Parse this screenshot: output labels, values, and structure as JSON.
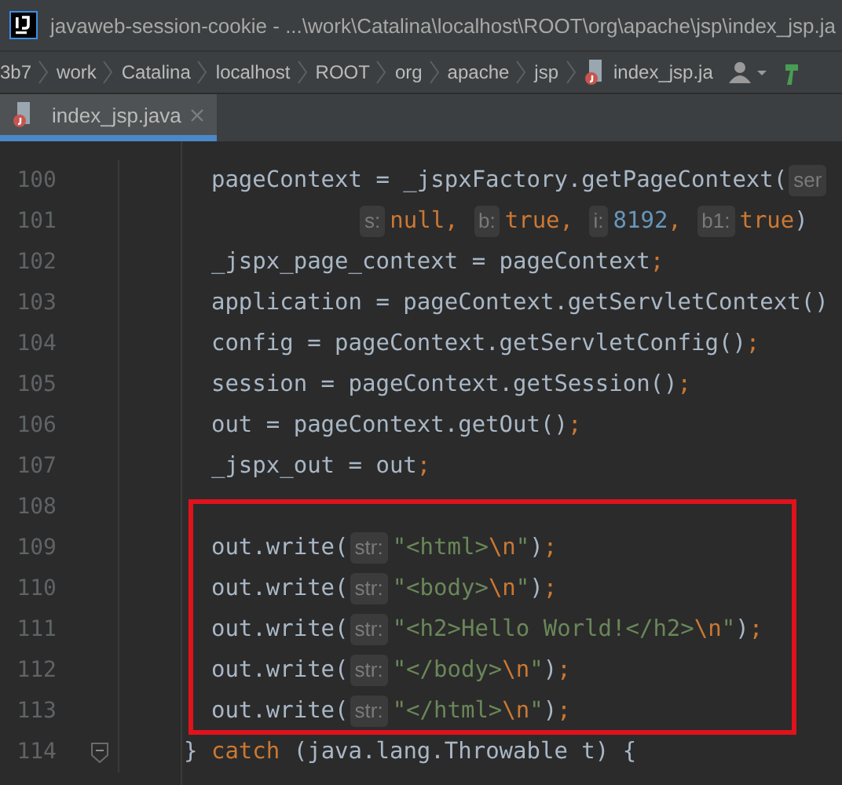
{
  "window": {
    "title": "javaweb-session-cookie - ...\\work\\Catalina\\localhost\\ROOT\\org\\apache\\jsp\\index_jsp.ja"
  },
  "breadcrumbs": [
    {
      "label": "3b7",
      "kind": "folder"
    },
    {
      "label": "work",
      "kind": "folder"
    },
    {
      "label": "Catalina",
      "kind": "folder"
    },
    {
      "label": "localhost",
      "kind": "folder"
    },
    {
      "label": "ROOT",
      "kind": "folder"
    },
    {
      "label": "org",
      "kind": "folder"
    },
    {
      "label": "apache",
      "kind": "folder"
    },
    {
      "label": "jsp",
      "kind": "folder"
    },
    {
      "label": "index_jsp.ja",
      "kind": "file"
    }
  ],
  "tabs": [
    {
      "label": "index_jsp.java",
      "selected": true
    }
  ],
  "editor": {
    "lines": [
      {
        "number": "100",
        "tokens": [
          {
            "kind": "plain",
            "text": "  pageContext = _jspxFactory.getPageContext("
          },
          {
            "kind": "hint",
            "text": "ser"
          }
        ]
      },
      {
        "number": "101",
        "kind": "continuation",
        "tokens": [
          {
            "kind": "hint",
            "text": "s:"
          },
          {
            "kind": "keyword",
            "text": "null"
          },
          {
            "kind": "punct",
            "text": ", "
          },
          {
            "kind": "hint",
            "text": "b:"
          },
          {
            "kind": "keyword",
            "text": "true"
          },
          {
            "kind": "punct",
            "text": ", "
          },
          {
            "kind": "hint",
            "text": "i:"
          },
          {
            "kind": "number",
            "text": "8192"
          },
          {
            "kind": "punct",
            "text": ", "
          },
          {
            "kind": "hint",
            "text": "b1:"
          },
          {
            "kind": "keyword",
            "text": "true"
          },
          {
            "kind": "plain",
            "text": ")"
          }
        ]
      },
      {
        "number": "102",
        "tokens": [
          {
            "kind": "plain",
            "text": "  _jspx_page_context = pageContext"
          },
          {
            "kind": "punct",
            "text": ";"
          }
        ]
      },
      {
        "number": "103",
        "tokens": [
          {
            "kind": "plain",
            "text": "  application = pageContext.getServletContext()"
          }
        ]
      },
      {
        "number": "104",
        "tokens": [
          {
            "kind": "plain",
            "text": "  config = pageContext.getServletConfig()"
          },
          {
            "kind": "punct",
            "text": ";"
          }
        ]
      },
      {
        "number": "105",
        "tokens": [
          {
            "kind": "plain",
            "text": "  session = pageContext.getSession()"
          },
          {
            "kind": "punct",
            "text": ";"
          }
        ]
      },
      {
        "number": "106",
        "tokens": [
          {
            "kind": "plain",
            "text": "  out = pageContext.getOut()"
          },
          {
            "kind": "punct",
            "text": ";"
          }
        ]
      },
      {
        "number": "107",
        "tokens": [
          {
            "kind": "plain",
            "text": "  _jspx_out = out"
          },
          {
            "kind": "punct",
            "text": ";"
          }
        ]
      },
      {
        "number": "108"
      },
      {
        "number": "109",
        "tokens": [
          {
            "kind": "plain",
            "text": "  out.write("
          },
          {
            "kind": "hint",
            "text": "str:"
          },
          {
            "kind": "string",
            "text": "\"<html>"
          },
          {
            "kind": "escape",
            "text": "\\n"
          },
          {
            "kind": "string",
            "text": "\""
          },
          {
            "kind": "plain",
            "text": ")"
          },
          {
            "kind": "punct",
            "text": ";"
          }
        ]
      },
      {
        "number": "110",
        "tokens": [
          {
            "kind": "plain",
            "text": "  out.write("
          },
          {
            "kind": "hint",
            "text": "str:"
          },
          {
            "kind": "string",
            "text": "\"<body>"
          },
          {
            "kind": "escape",
            "text": "\\n"
          },
          {
            "kind": "string",
            "text": "\""
          },
          {
            "kind": "plain",
            "text": ")"
          },
          {
            "kind": "punct",
            "text": ";"
          }
        ]
      },
      {
        "number": "111",
        "tokens": [
          {
            "kind": "plain",
            "text": "  out.write("
          },
          {
            "kind": "hint",
            "text": "str:"
          },
          {
            "kind": "string",
            "text": "\"<h2>Hello World!</h2>"
          },
          {
            "kind": "escape",
            "text": "\\n"
          },
          {
            "kind": "string",
            "text": "\""
          },
          {
            "kind": "plain",
            "text": ")"
          },
          {
            "kind": "punct",
            "text": ";"
          }
        ]
      },
      {
        "number": "112",
        "tokens": [
          {
            "kind": "plain",
            "text": "  out.write("
          },
          {
            "kind": "hint",
            "text": "str:"
          },
          {
            "kind": "string",
            "text": "\"</body>"
          },
          {
            "kind": "escape",
            "text": "\\n"
          },
          {
            "kind": "string",
            "text": "\""
          },
          {
            "kind": "plain",
            "text": ")"
          },
          {
            "kind": "punct",
            "text": ";"
          }
        ]
      },
      {
        "number": "113",
        "tokens": [
          {
            "kind": "plain",
            "text": "  out.write("
          },
          {
            "kind": "hint",
            "text": "str:"
          },
          {
            "kind": "string",
            "text": "\"</html>"
          },
          {
            "kind": "escape",
            "text": "\\n"
          },
          {
            "kind": "string",
            "text": "\""
          },
          {
            "kind": "plain",
            "text": ")"
          },
          {
            "kind": "punct",
            "text": ";"
          }
        ]
      },
      {
        "number": "114",
        "fold": true,
        "tokens": [
          {
            "kind": "plain",
            "text": "} "
          },
          {
            "kind": "keyword",
            "text": "catch"
          },
          {
            "kind": "plain",
            "text": " (java.lang.Throwable t) {"
          }
        ]
      }
    ]
  }
}
